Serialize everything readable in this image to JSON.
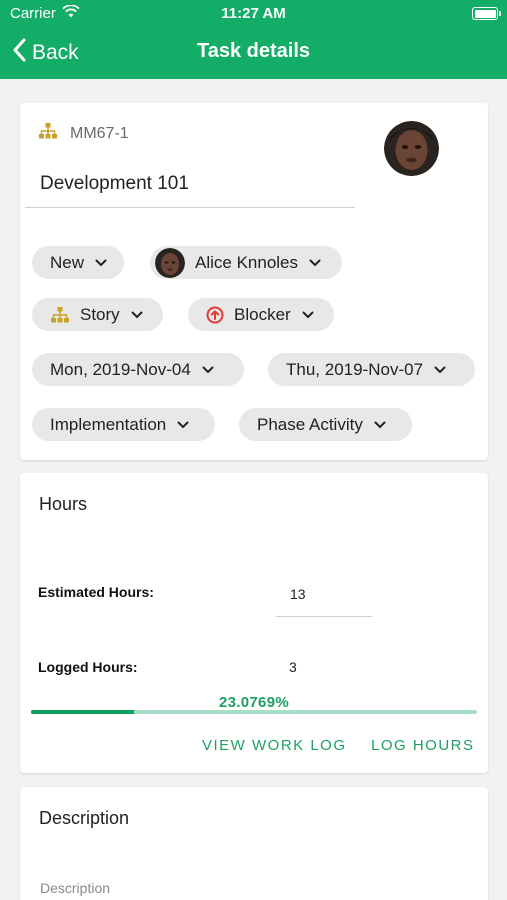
{
  "status_bar": {
    "carrier": "Carrier",
    "time": "11:27 AM"
  },
  "nav": {
    "back_label": "Back",
    "title": "Task details"
  },
  "task": {
    "id": "MM67-1",
    "title": "Development 101",
    "chips": {
      "status": "New",
      "assignee": "Alice Knnoles",
      "type": "Story",
      "priority": "Blocker",
      "start_date": "Mon, 2019-Nov-04",
      "end_date": "Thu, 2019-Nov-07",
      "phase": "Implementation",
      "activity": "Phase Activity"
    }
  },
  "hours": {
    "title": "Hours",
    "estimated_label": "Estimated Hours:",
    "estimated_value": "13",
    "logged_label": "Logged Hours:",
    "logged_value": "3",
    "progress_text": "23.0769%",
    "progress_fraction": 0.230769,
    "view_work_log": "VIEW WORK LOG",
    "log_hours": "LOG HOURS"
  },
  "description": {
    "title": "Description",
    "placeholder": "Description"
  },
  "colors": {
    "accent": "#13ad68",
    "chip_bg": "#e8e8e8",
    "priority_red": "#e53935",
    "story_gold": "#c9a227"
  }
}
